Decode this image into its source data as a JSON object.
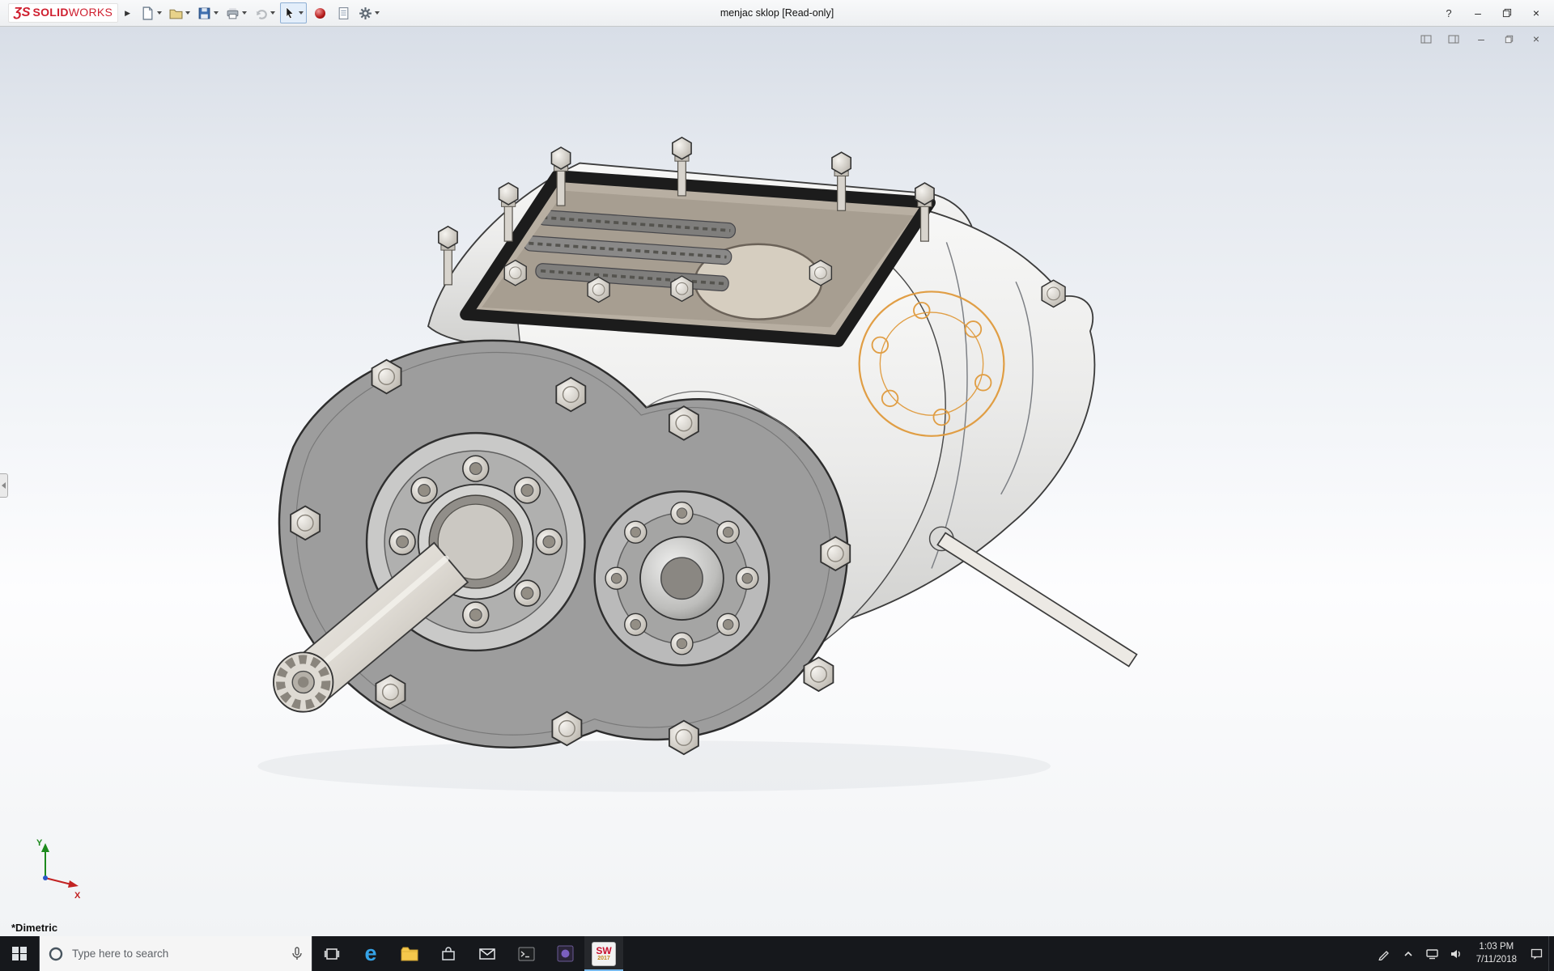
{
  "app": {
    "brand_ds": "ƷS",
    "brand_bold": "SOLID",
    "brand_light": "WORKS"
  },
  "titlebar": {
    "document_title": "menjac sklop [Read-only]",
    "expander": "▶",
    "controls": {
      "help": "?",
      "minimize": "–",
      "close": "×"
    }
  },
  "toolbar": {
    "tools": [
      "new-document",
      "open",
      "save",
      "print",
      "undo",
      "select",
      "appearance",
      "file-properties",
      "options"
    ]
  },
  "child_window": {
    "minimize": "–",
    "close": "×"
  },
  "viewport": {
    "view_orientation": "*Dimetric",
    "triad": {
      "x": "X",
      "y": "Y"
    }
  },
  "taskbar": {
    "search_placeholder": "Type here to search",
    "clock_time": "1:03 PM",
    "clock_date": "7/11/2018",
    "sw_icon_line1": "SW",
    "sw_icon_line2": "2017",
    "edge_letter": "e"
  },
  "colors": {
    "brand_red": "#cf1f2f",
    "highlight_orange": "#e09a3c",
    "taskbar_bg": "#16181c",
    "active_app_underline": "#76b9ed"
  }
}
